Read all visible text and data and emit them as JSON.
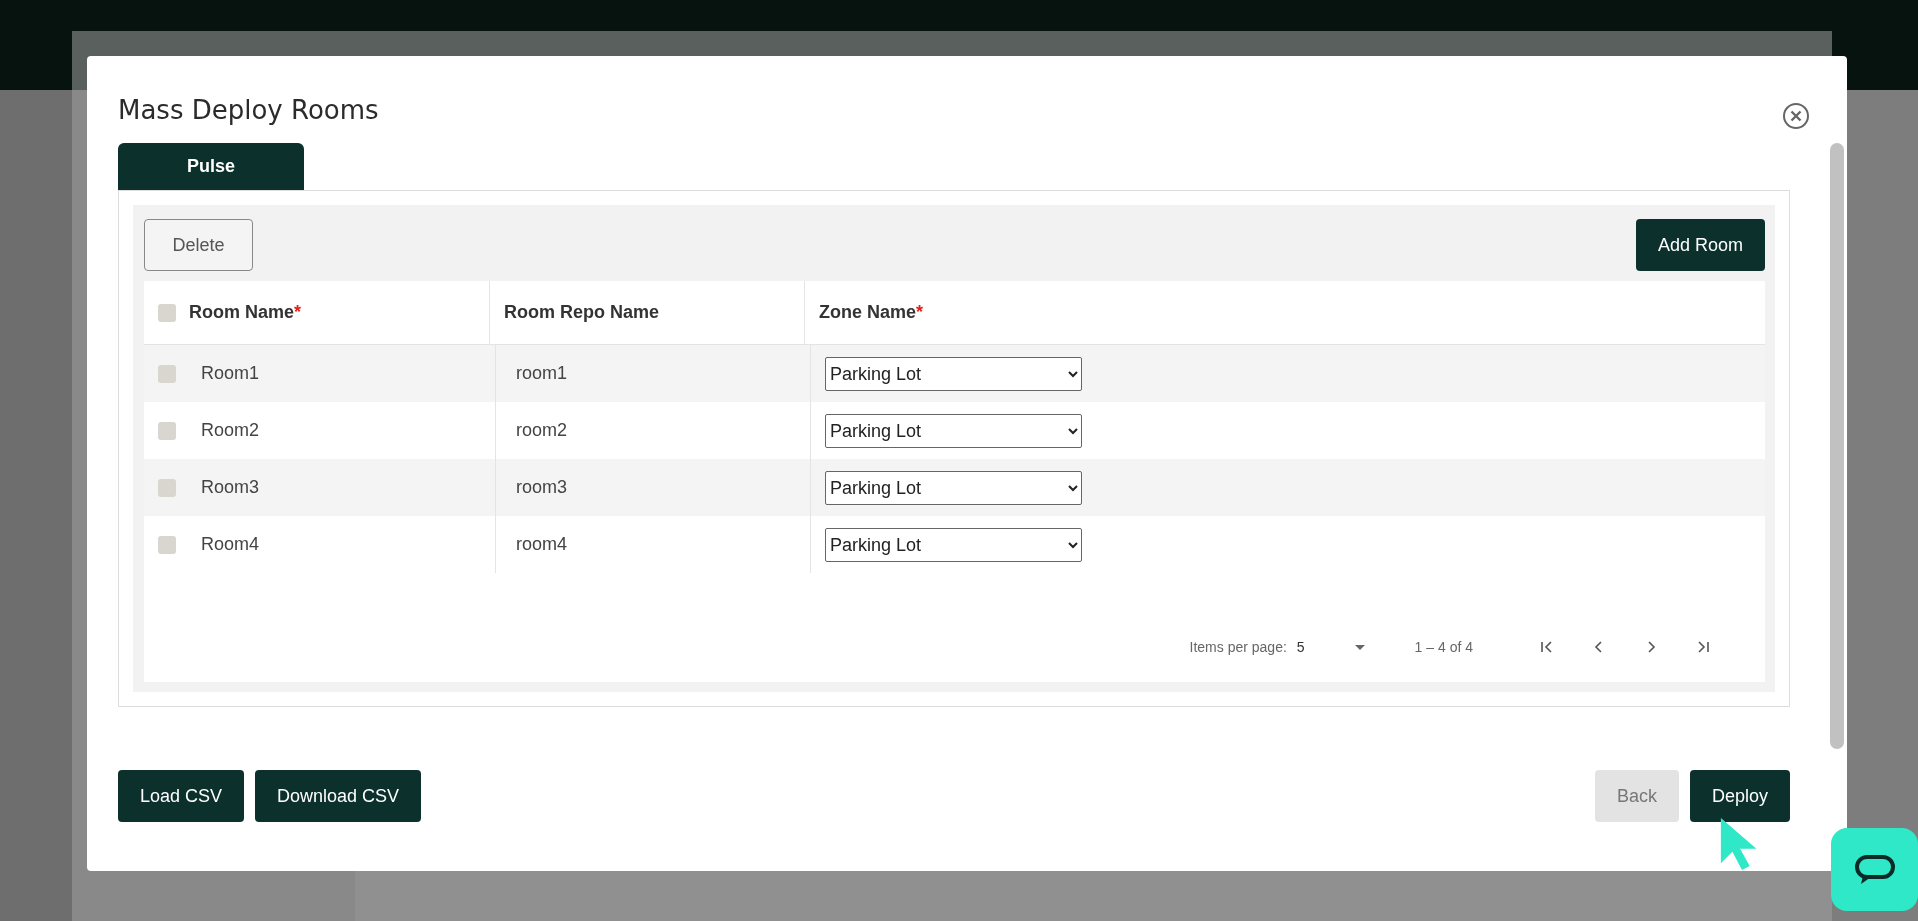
{
  "dialog": {
    "title": "Mass Deploy Rooms"
  },
  "tabs": [
    {
      "label": "Pulse",
      "selected": true
    }
  ],
  "toolbar": {
    "delete_button": "Delete",
    "add_button": "Add Room"
  },
  "table": {
    "select_all_checked": false,
    "columns": [
      {
        "label": "Room Name",
        "mark": "*"
      },
      {
        "label": "Room Repo Name"
      },
      {
        "label": "Zone Name",
        "mark": "*"
      }
    ],
    "rows": [
      {
        "room_name": "Room1",
        "repo_name": "room1",
        "zone": "Parking Lot",
        "checked": false
      },
      {
        "room_name": "Room2",
        "repo_name": "room2",
        "zone": "Parking Lot",
        "checked": false
      },
      {
        "room_name": "Room3",
        "repo_name": "room3",
        "zone": "Parking Lot",
        "checked": false
      },
      {
        "room_name": "Room4",
        "repo_name": "room4",
        "zone": "Parking Lot",
        "checked": false
      }
    ]
  },
  "pagination": {
    "items_per_page_label": "Items per page:",
    "page_size": "5",
    "range": "1 – 4 of 4"
  },
  "footer": {
    "left_buttons": [
      {
        "label": "Load CSV",
        "disabled": false
      },
      {
        "label": "Download CSV",
        "disabled": false
      }
    ],
    "right_buttons": [
      {
        "label": "Back",
        "disabled": true
      },
      {
        "label": "Deploy",
        "disabled": false
      }
    ]
  }
}
